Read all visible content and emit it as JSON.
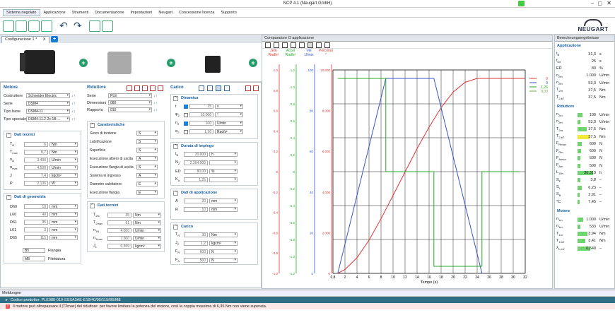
{
  "window": {
    "title": "NCP 4.1 (Neugart GmbH)"
  },
  "menu": [
    "Sistema riegolato",
    "Applicazione",
    "Strumenti",
    "Documentazione",
    "Impostazioni",
    "Neugart",
    "Concessione licenza",
    "Supporto"
  ],
  "brand": "NEUGART",
  "config_tab": "Configurazione 1 *",
  "motore": {
    "title": "Motore",
    "rows": [
      {
        "label": "Costruttore",
        "value": "Schneider Electric"
      },
      {
        "label": "Serie",
        "value": "DSM4"
      },
      {
        "label": "Tipo base",
        "value": "DSM4-11"
      },
      {
        "label": "Tipo speciale",
        "value": "DSM4-11.2-2x-1B-..."
      }
    ],
    "dati_tecnici": {
      "title": "Dati tecnici",
      "rows": [
        {
          "sym": "T",
          "sub": "N",
          "value": "6",
          "unit": "Nm"
        },
        {
          "sym": "T",
          "sub": "max",
          "value": "8,7",
          "unit": "Nm"
        },
        {
          "sym": "n",
          "sub": "N",
          "value": "3.400",
          "unit": "U/min"
        },
        {
          "sym": "n",
          "sub": "max",
          "value": "4.500",
          "unit": "U/min"
        },
        {
          "sym": "J",
          "sub": "",
          "value": "7,4",
          "unit": "kgcm²"
        },
        {
          "sym": "P",
          "sub": "",
          "value": "2.136",
          "unit": "W"
        }
      ]
    },
    "dati_geometria": {
      "title": "Dati di geometria",
      "rows": [
        {
          "label": "D60",
          "value": "19",
          "unit": "mm"
        },
        {
          "label": "L60",
          "value": "40",
          "unit": "mm"
        },
        {
          "label": "D61",
          "value": "95",
          "unit": "mm"
        },
        {
          "label": "L61",
          "value": "3",
          "unit": "mm"
        },
        {
          "label": "D65",
          "value": "115",
          "unit": "mm"
        }
      ],
      "flangia_code": "B5",
      "flangia_label": "Flangia",
      "filettatura_code": "M8",
      "filettatura_label": "Filettatura"
    }
  },
  "riduttore": {
    "title": "Riduttore",
    "rows": [
      {
        "label": "Serie",
        "value": "PLE"
      },
      {
        "label": "Dimensioni",
        "value": "080"
      },
      {
        "label": "Rapporto",
        "value": "010"
      }
    ],
    "caratteristiche": {
      "title": "Caratteristiche",
      "rows": [
        {
          "label": "Gioco di torsione",
          "value": "S"
        },
        {
          "label": "Lubrificazione",
          "value": "S"
        },
        {
          "label": "Superficie",
          "value": "S"
        },
        {
          "label": "Esecuzione albero di uscita",
          "value": "A"
        },
        {
          "label": "Esecuzione flangia di uscita",
          "value": "S"
        },
        {
          "label": "Sistema in ingresso",
          "value": "A"
        },
        {
          "label": "Diametro calettatore",
          "value": "E"
        },
        {
          "label": "Esecuzione flangia",
          "value": "E"
        }
      ]
    },
    "dati_tecnici": {
      "title": "Dati tecnici",
      "rows": [
        {
          "sym": "T",
          "sub": "2N",
          "value": "35",
          "unit": "Nm"
        },
        {
          "sym": "T",
          "sub": "2max",
          "value": "61",
          "unit": "Nm"
        },
        {
          "sym": "n",
          "sub": "1N",
          "value": "4.000",
          "unit": "U/min"
        },
        {
          "sym": "n",
          "sub": "1max",
          "value": "7.000",
          "unit": "U/min"
        },
        {
          "sym": "J",
          "sub": "1",
          "value": "0,359",
          "unit": "kgcm²"
        }
      ]
    }
  },
  "carico": {
    "title": "Carico",
    "dinamica": {
      "title": "Dinamica",
      "rows": [
        {
          "sym": "t",
          "checked": true,
          "value": "25",
          "unit": "s"
        },
        {
          "sym": "φ",
          "sub": "2",
          "checked": false,
          "value": "10.000",
          "unit": "°"
        },
        {
          "sym": "n",
          "sub": "2",
          "checked": true,
          "value": "100",
          "unit": "U/min"
        },
        {
          "sym": "α",
          "sub": "2",
          "checked": false,
          "value": "1,26",
          "unit": "Rad/s²"
        }
      ]
    },
    "durata": {
      "title": "Durata di impiego",
      "rows": [
        {
          "sym": "t",
          "sub": "B",
          "value": "20.000",
          "unit": "h"
        },
        {
          "sym": "N",
          "sub": "Z",
          "value": "2.304.000",
          "unit": ""
        },
        {
          "sym": "ED",
          "sub": "",
          "value": "80,00",
          "unit": "%"
        },
        {
          "sym": "K",
          "sub": "A",
          "value": "1,25",
          "unit": ""
        }
      ]
    },
    "applicazione": {
      "title": "Dati di applicazione",
      "rows": [
        {
          "sym": "A",
          "value": "20",
          "unit": "mm"
        },
        {
          "sym": "R",
          "value": "10",
          "unit": "mm"
        }
      ]
    },
    "carico_sec": {
      "title": "Carico",
      "rows": [
        {
          "sym": "T",
          "sub": "R",
          "value": "30",
          "unit": "Nm"
        },
        {
          "sym": "J",
          "sub": "2",
          "value": "1,2",
          "unit": "kgcm²"
        },
        {
          "sym": "F",
          "sub": "R",
          "value": "600",
          "unit": "N"
        },
        {
          "sym": "F",
          "sub": "A",
          "value": "500",
          "unit": "N"
        }
      ]
    }
  },
  "chart_window_title": "Comparatore O applicazione",
  "chart_data": {
    "type": "line",
    "xlabel": "Tempo (s)",
    "xlim": [
      0,
      32
    ],
    "x_ticks": [
      "0,8",
      "2",
      "4",
      "6",
      "8",
      "10",
      "12",
      "14",
      "16",
      "18",
      "20",
      "22",
      "24",
      "26",
      "28",
      "30",
      "32"
    ],
    "axes": [
      {
        "name": "Jerk\nRad/s³",
        "color": "#d33",
        "ticks": [
          "1,0",
          "0,8",
          "0,6",
          "0,4",
          "0,2",
          "0",
          "-0,2",
          "-0,4",
          "-0,6",
          "-0,8",
          "-1,0"
        ]
      },
      {
        "name": "Accel\nRad/s²",
        "color": "#2a2",
        "ticks": [
          "1,2",
          "1,0",
          "0,8",
          "0,6",
          "0,4",
          "0,2",
          "0",
          "-0,2",
          "-0,4",
          "-0,6",
          "-0,8",
          "-1,0",
          "-1,2"
        ]
      },
      {
        "name": "Vel\nU/min",
        "color": "#35c",
        "ticks": [
          "100",
          "80",
          "60",
          "40",
          "20",
          "0"
        ]
      },
      {
        "name": "Percorso\n°",
        "color": "#d33",
        "ticks": [
          "10.000",
          "8.000",
          "6.000",
          "4.000",
          "2.000",
          "0"
        ]
      }
    ],
    "series": [
      {
        "color": "#d33",
        "legend": "0",
        "x": [
          0.8,
          2,
          4,
          6,
          8,
          10,
          12,
          14,
          16,
          18,
          20,
          22,
          24,
          25,
          32
        ],
        "y_frac": [
          0,
          0.02,
          0.08,
          0.17,
          0.28,
          0.4,
          0.52,
          0.64,
          0.75,
          0.85,
          0.93,
          0.98,
          1.0,
          1.0,
          1.0
        ]
      },
      {
        "color": "#35c",
        "legend": "0",
        "x": [
          0.8,
          8.8,
          16.8,
          24.8,
          25
        ],
        "y_frac": [
          0,
          1,
          1,
          0,
          0
        ]
      },
      {
        "color": "#2a2",
        "legend": "1,26",
        "x": [
          0.8,
          8.8,
          8.8,
          16.8,
          16.8,
          24.8,
          24.8,
          25.5,
          25.5,
          31
        ],
        "y_frac": [
          1,
          1,
          0.5,
          0.5,
          0,
          0,
          0.5,
          0.5,
          0.5,
          0.5
        ]
      },
      {
        "color": "#7a4",
        "legend": "0,00",
        "x": [],
        "y_frac": []
      }
    ]
  },
  "risultati": {
    "title": "Berechnungsergebnisse",
    "applicazione": {
      "title": "Applicazione",
      "rows": [
        {
          "sym": "t",
          "sub": "B",
          "value": "31,3",
          "unit": "s"
        },
        {
          "sym": "t",
          "sub": "tot",
          "value": "25",
          "unit": "s"
        },
        {
          "sym": "ED",
          "sub": "",
          "value": "80",
          "unit": "%"
        },
        {
          "sym": "n",
          "sub": "2m",
          "value": "1.000",
          "unit": "U/min"
        },
        {
          "sym": "n",
          "sub": "2m",
          "value": "53,3",
          "unit": "U/min"
        },
        {
          "sym": "T",
          "sub": "2m",
          "value": "37,5",
          "unit": "Nm"
        },
        {
          "sym": "T",
          "sub": "2,bT",
          "value": "37,5",
          "unit": "Nm"
        }
      ]
    },
    "riduttore": {
      "title": "Riduttore",
      "rows": [
        {
          "sym": "n",
          "sub": "2m",
          "value": "100",
          "unit": "U/min",
          "bar": 0.25,
          "tone": "g"
        },
        {
          "sym": "n",
          "sub": "2m",
          "value": "53,3",
          "unit": "U/min",
          "bar": 0.15,
          "tone": "g"
        },
        {
          "sym": "T",
          "sub": "2m",
          "value": "37,5",
          "unit": "Nm",
          "bar": 0.45,
          "tone": "g"
        },
        {
          "sym": "T",
          "sub": "2,bT",
          "value": "37,5",
          "unit": "Nm",
          "bar": 0.6,
          "tone": "y"
        },
        {
          "sym": "F",
          "sub": "Rmax",
          "value": "600",
          "unit": "N",
          "bar": 0.2,
          "tone": "g"
        },
        {
          "sym": "F",
          "sub": "Rm",
          "value": "600",
          "unit": "N",
          "bar": 0.18,
          "tone": "g"
        },
        {
          "sym": "F",
          "sub": "Amax",
          "value": "500",
          "unit": "N",
          "bar": 0.15,
          "tone": "g"
        },
        {
          "sym": "F",
          "sub": "Am",
          "value": "500",
          "unit": "N",
          "bar": 0.14,
          "tone": "g"
        },
        {
          "sym": "L",
          "sub": "10h",
          "value": "36.313",
          "unit": "h",
          "bar": 0.8,
          "tone": "g"
        },
        {
          "sym": "S",
          "sub": "F",
          "value": "3,8",
          "unit": "–",
          "bar": 0.15,
          "tone": "g"
        },
        {
          "sym": "S",
          "sub": "L",
          "value": "6,23",
          "unit": "–",
          "bar": 0.2,
          "tone": "g"
        },
        {
          "sym": "S",
          "sub": "B",
          "value": "2,91",
          "unit": "–",
          "bar": 0.12,
          "tone": "g"
        },
        {
          "sym": "°C",
          "sub": "",
          "value": "7,45",
          "unit": "–",
          "bar": 0.1,
          "tone": "g"
        }
      ]
    },
    "motore": {
      "title": "Motore",
      "rows": [
        {
          "sym": "n",
          "sub": "1m",
          "value": "1.000",
          "unit": "U/min",
          "bar": 0.3,
          "tone": "g"
        },
        {
          "sym": "n",
          "sub": "1m",
          "value": "533",
          "unit": "U/min",
          "bar": 0.15,
          "tone": "g"
        },
        {
          "sym": "T",
          "sub": "1m",
          "value": "3,94",
          "unit": "Nm",
          "bar": 0.5,
          "tone": "g"
        },
        {
          "sym": "T",
          "sub": "1m2",
          "value": "3,41",
          "unit": "Nm",
          "bar": 0.4,
          "tone": "g"
        },
        {
          "sym": "λ",
          "sub": "1,m2",
          "value": "0,648",
          "unit": "–",
          "bar": 0.65,
          "tone": "g"
        }
      ]
    }
  },
  "messages": {
    "title": "Meldungen",
    "product_code": "Codice prodottor: PLE080-010-SSSA3AE-E19/40/95/115/B5/M8",
    "warning": "Il motore può oltrepassare il |T2max| del riduttore: per favore limitare la potenza del motore, così la coppia massima di 6,35 Nm non viene superata."
  }
}
